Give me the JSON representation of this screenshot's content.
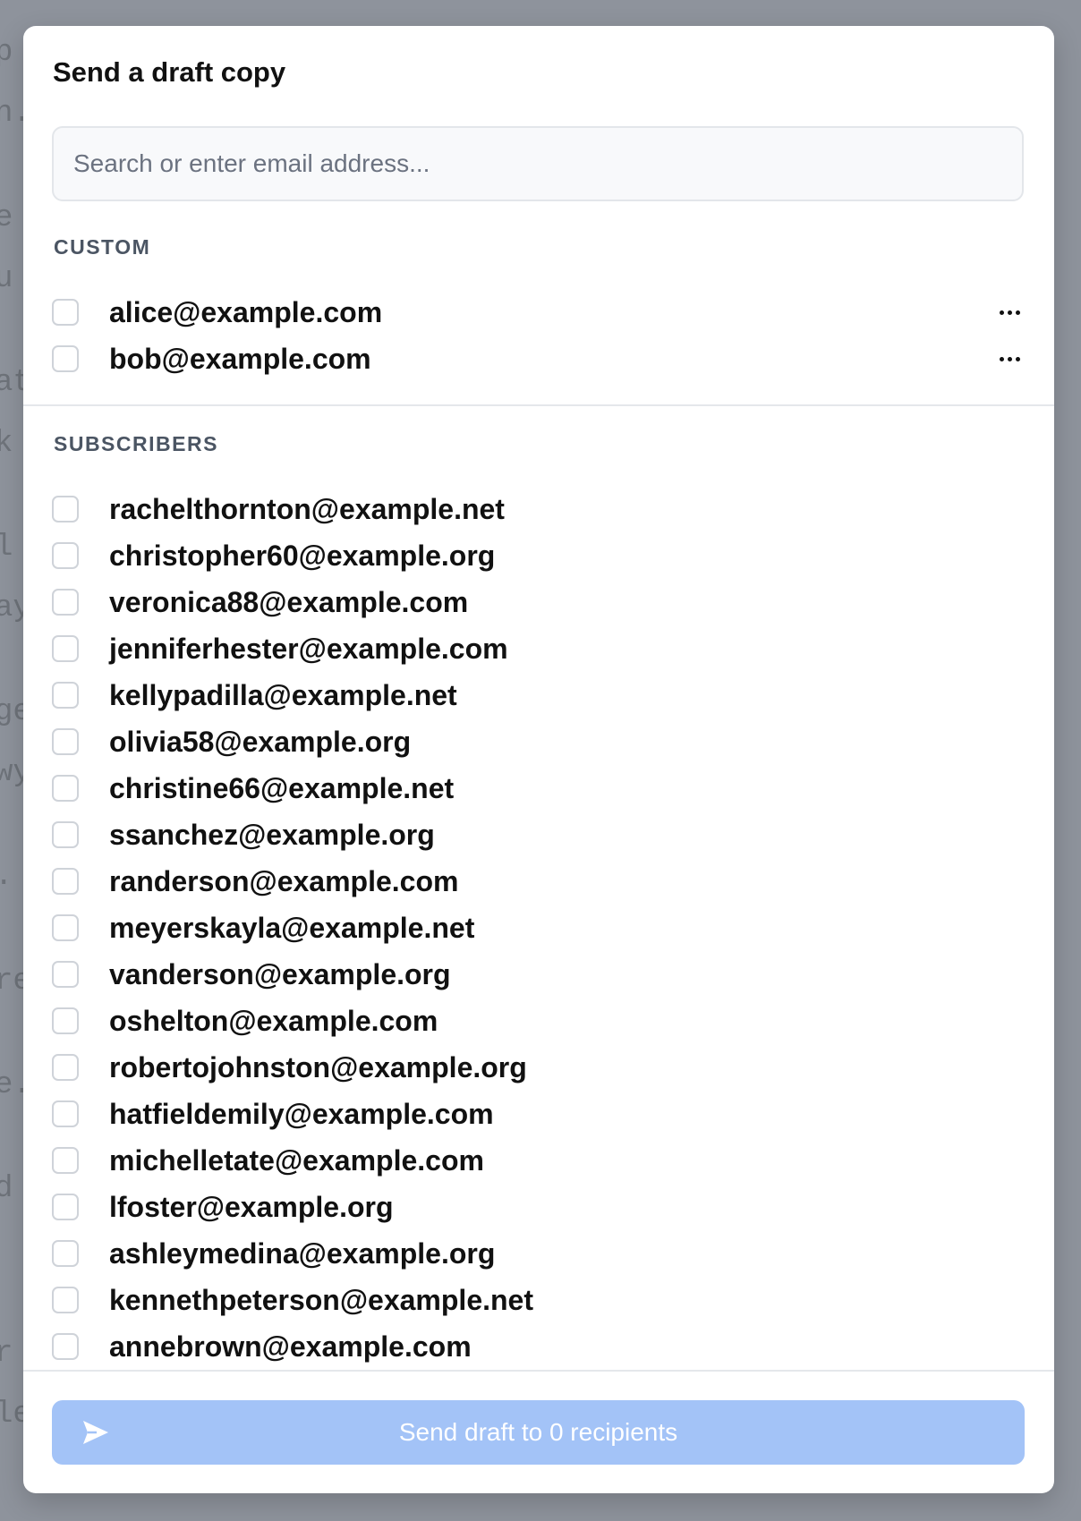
{
  "background_doc": {
    "fragments": [
      "p",
      "n.",
      "e",
      "u",
      "at",
      "k",
      "l",
      "ay",
      "ge",
      "wy",
      ".",
      "re",
      "e.",
      "d",
      "r",
      "le"
    ]
  },
  "dialog": {
    "title": "Send a draft copy",
    "search_placeholder": "Search or enter email address...",
    "search_value": ""
  },
  "custom": {
    "heading": "CUSTOM",
    "items": [
      {
        "email": "alice@example.com",
        "checked": false
      },
      {
        "email": "bob@example.com",
        "checked": false
      }
    ]
  },
  "subscribers": {
    "heading": "SUBSCRIBERS",
    "items": [
      {
        "email": "rachelthornton@example.net",
        "checked": false
      },
      {
        "email": "christopher60@example.org",
        "checked": false
      },
      {
        "email": "veronica88@example.com",
        "checked": false
      },
      {
        "email": "jenniferhester@example.com",
        "checked": false
      },
      {
        "email": "kellypadilla@example.net",
        "checked": false
      },
      {
        "email": "olivia58@example.org",
        "checked": false
      },
      {
        "email": "christine66@example.net",
        "checked": false
      },
      {
        "email": "ssanchez@example.org",
        "checked": false
      },
      {
        "email": "randerson@example.com",
        "checked": false
      },
      {
        "email": "meyerskayla@example.net",
        "checked": false
      },
      {
        "email": "vanderson@example.org",
        "checked": false
      },
      {
        "email": "oshelton@example.com",
        "checked": false
      },
      {
        "email": "robertojohnston@example.org",
        "checked": false
      },
      {
        "email": "hatfieldemily@example.com",
        "checked": false
      },
      {
        "email": "michelletate@example.com",
        "checked": false
      },
      {
        "email": "lfoster@example.org",
        "checked": false
      },
      {
        "email": "ashleymedina@example.org",
        "checked": false
      },
      {
        "email": "kennethpeterson@example.net",
        "checked": false
      },
      {
        "email": "annebrown@example.com",
        "checked": false
      }
    ]
  },
  "footer": {
    "send_label": "Send draft to 0 recipients",
    "send_icon": "paper-plane-icon",
    "button_color": "#a3c3f7"
  }
}
